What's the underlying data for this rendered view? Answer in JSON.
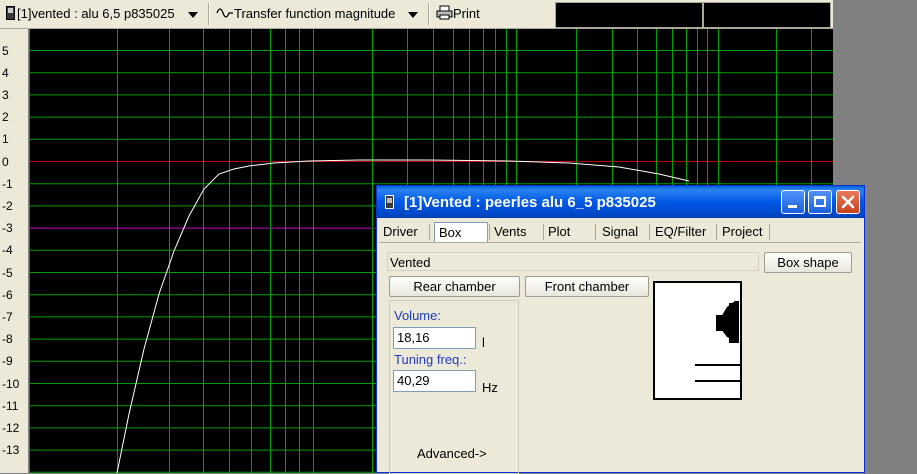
{
  "toolbar": {
    "project_label": "[1]vented : alu 6,5 p835025",
    "plot_selector_label": "Transfer function magnitude",
    "print_label": "Print",
    "icons": {
      "project": "file-icon",
      "plot": "sine-wave-icon",
      "print": "printer-icon"
    }
  },
  "plot": {
    "y_ticks": [
      "5",
      "4",
      "3",
      "2",
      "1",
      "0",
      "-1",
      "-2",
      "-3",
      "-4",
      "-5",
      "-6",
      "-7",
      "-8",
      "-9",
      "-10",
      "-11",
      "-12",
      "-13"
    ],
    "colors": {
      "background": "#000000",
      "grid": "#00a000",
      "zero_line": "#c00000",
      "minus3_line": "#c000c0",
      "curve": "#ffffff"
    }
  },
  "dialog": {
    "title": "[1]Vented : peerles alu 6_5 p835025",
    "tabs": [
      {
        "label": "Driver",
        "selected": false
      },
      {
        "label": "Box",
        "selected": true
      },
      {
        "label": "Vents",
        "selected": false
      },
      {
        "label": "Plot",
        "selected": false
      },
      {
        "label": "Signal",
        "selected": false
      },
      {
        "label": "EQ/Filter",
        "selected": false
      },
      {
        "label": "Project",
        "selected": false
      }
    ],
    "box_type_value": "Vented",
    "box_shape_button": "Box shape",
    "rear_chamber_button": "Rear chamber",
    "front_chamber_button": "Front chamber",
    "volume_label": "Volume:",
    "volume_value": "18,16",
    "volume_unit": "l",
    "tuning_label": "Tuning freq.:",
    "tuning_value": "40,29",
    "tuning_unit": "Hz",
    "advanced_link": "Advanced->"
  }
}
